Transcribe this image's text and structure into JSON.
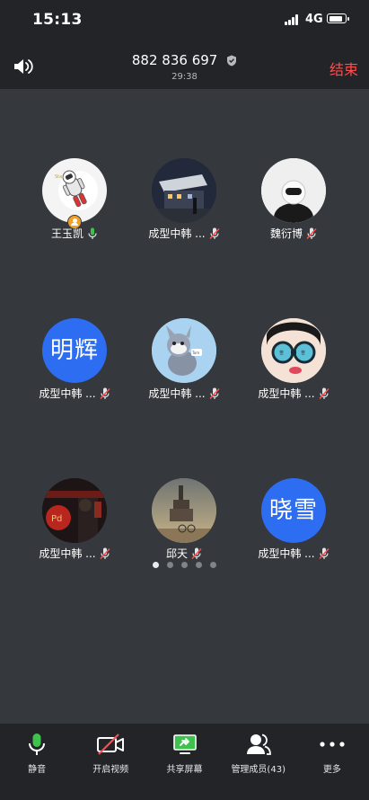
{
  "status_bar": {
    "time": "15:13",
    "network": "4G",
    "battery_icon": "battery-icon",
    "signal_icon": "signal-icon"
  },
  "header": {
    "meeting_id": "882 836 697",
    "elapsed": "29:38",
    "end_label": "结束",
    "speaker_icon": "speaker-icon",
    "shield_icon": "shield-icon"
  },
  "colors": {
    "end": "#ff4d4d",
    "avatar_blue": "#2d6df2",
    "mic_on": "#3fc24d",
    "mic_muted": "#ff4d4d",
    "host_badge": "#f0a028",
    "share_screen": "#3fc24d"
  },
  "participants": [
    {
      "name": "王玉凯",
      "mic": "on",
      "host": true,
      "avatar": "astronaut-image"
    },
    {
      "name": "成型中韩 ...",
      "mic": "muted",
      "avatar": "night-building-image"
    },
    {
      "name": "魏衍博",
      "mic": "muted",
      "avatar": "astronaut-white-image"
    },
    {
      "name": "成型中韩 ...",
      "mic": "muted",
      "avatar_text": "明辉"
    },
    {
      "name": "成型中韩 ...",
      "mic": "muted",
      "avatar": "cartoon-cat-image"
    },
    {
      "name": "成型中韩 ...",
      "mic": "muted",
      "avatar": "cartoon-goggles-image"
    },
    {
      "name": "成型中韩 ...",
      "mic": "muted",
      "avatar": "red-street-image"
    },
    {
      "name": "邱天",
      "mic": "muted",
      "avatar": "tower-image"
    },
    {
      "name": "成型中韩 ...",
      "mic": "muted",
      "avatar_text": "晓雪"
    }
  ],
  "pagination": {
    "pages": 5,
    "current": 1
  },
  "toolbar": {
    "mute_label": "静音",
    "video_label": "开启视频",
    "share_label": "共享屏幕",
    "members_label": "管理成员(43)",
    "more_label": "更多"
  }
}
